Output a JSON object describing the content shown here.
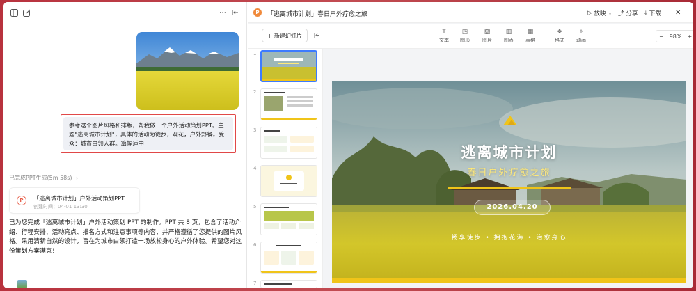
{
  "left": {
    "message": "参考这个图片风格和排版，帮我做一个户外活动策划PPT。主题\"逃离城市计划\"，具体的活动为徒步，观花，户外野餐。受众：城市白领人群。篇幅适中",
    "status": "已完成PPT生成(5m 58s)",
    "card": {
      "title": "「逃离城市计划」户外活动策划PPT",
      "meta": "创建时间：04-01 13:30"
    },
    "summary": "已为您完成「逃离城市计划」户外活动策划 PPT 的制作。PPT 共 8 页，包含了活动介绍、行程安排、活动亮点、报名方式和注意事项等内容，并严格遵循了您提供的图片风格。采用清新自然的设计，旨在为城市白领打造一场放松身心的户外体验。希望您对这份策划方案满意！"
  },
  "header": {
    "logo": "P",
    "title": "「逃离城市计划」春日户外疗愈之旅",
    "play": "放映",
    "share": "分享",
    "download": "下载"
  },
  "toolbar": {
    "new_slide": "新建幻灯片",
    "tools": [
      "文本",
      "图形",
      "图片",
      "图表",
      "表格",
      "格式",
      "动画"
    ],
    "zoom": "98%"
  },
  "thumbs": {
    "numbers": [
      "1",
      "2",
      "3",
      "4",
      "5",
      "6",
      "7"
    ]
  },
  "slide": {
    "title": "逃离城市计划",
    "subtitle": "春日户外疗愈之旅",
    "date": "2026.04.20",
    "tags": "畅享徒步  •  拥抱花海  •  治愈身心"
  },
  "colors": {
    "accent": "#3d7bff",
    "highlight": "#e14848",
    "yellow": "#f0c419"
  }
}
